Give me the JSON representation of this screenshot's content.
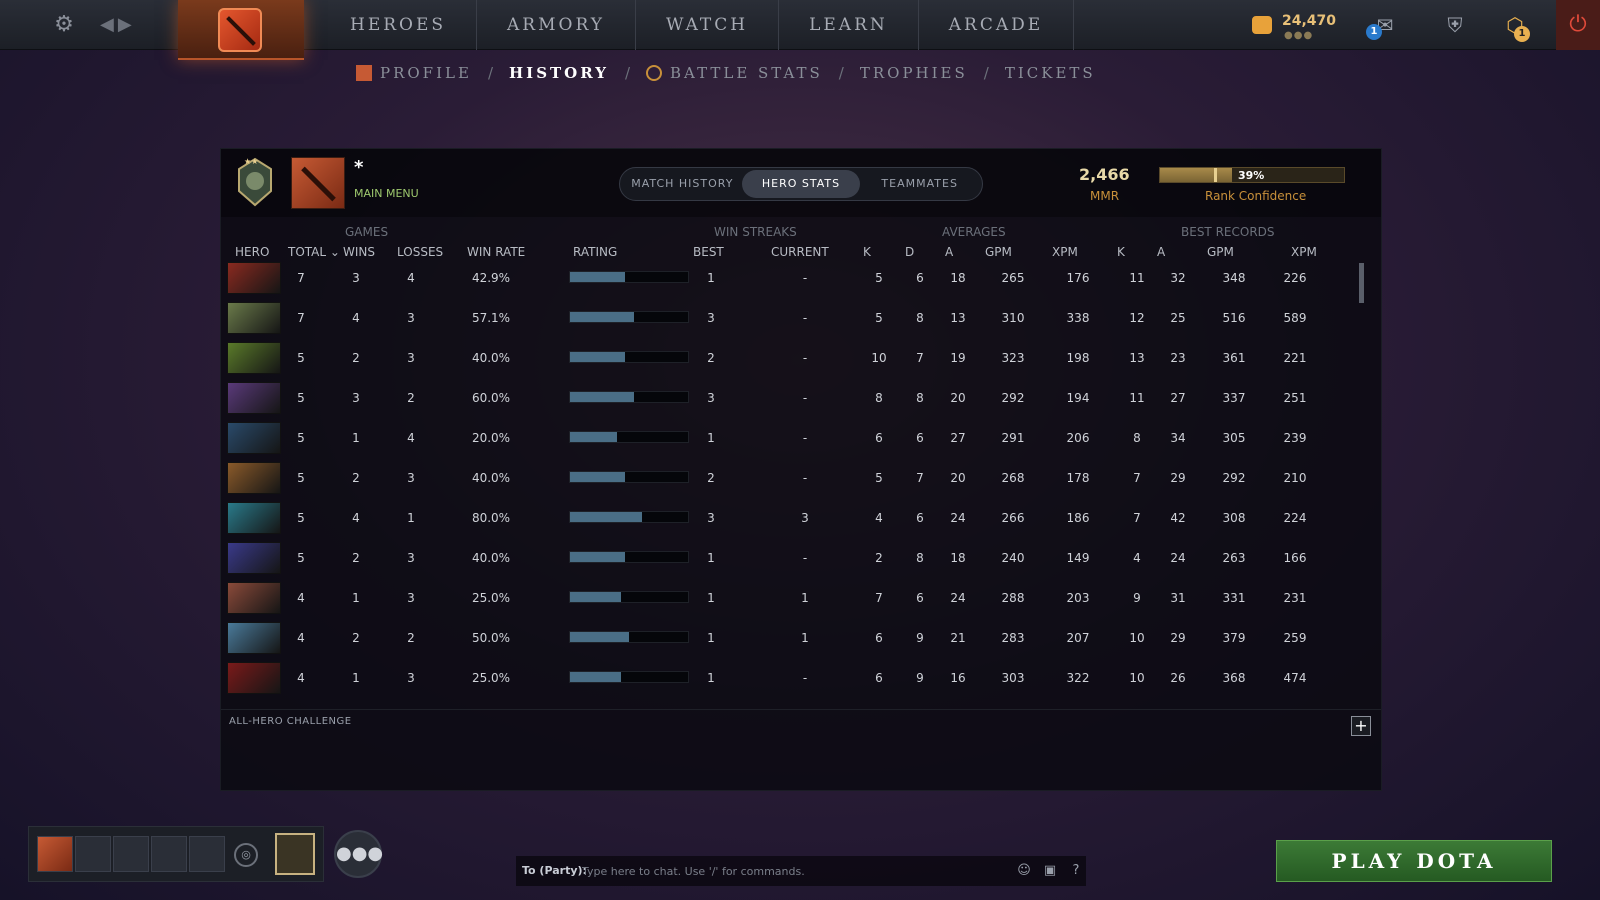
{
  "nav": {
    "items": [
      "HEROES",
      "ARMORY",
      "WATCH",
      "LEARN",
      "ARCADE"
    ],
    "currency": "24,470",
    "notification_count": "1",
    "plus_badge": "1"
  },
  "subnav": {
    "profile": "PROFILE",
    "history": "HISTORY",
    "battle_stats": "BATTLE STATS",
    "trophies": "TROPHIES",
    "tickets": "TICKETS",
    "separator": "/"
  },
  "profile": {
    "name": "*",
    "status": "MAIN MENU",
    "mmr": "2,466",
    "mmr_label": "MMR",
    "rank_confidence_pct": "39%",
    "rank_confidence_value": 39,
    "rank_confidence_label": "Rank Confidence"
  },
  "tabs": {
    "match_history": "MATCH HISTORY",
    "hero_stats": "HERO STATS",
    "teammates": "TEAMMATES"
  },
  "table": {
    "groups": {
      "games": "GAMES",
      "win_streaks": "WIN STREAKS",
      "averages": "AVERAGES",
      "best_records": "BEST RECORDS"
    },
    "headers": {
      "hero": "HERO",
      "total": "TOTAL ⌄",
      "wins": "WINS",
      "losses": "LOSSES",
      "win_rate": "WIN RATE",
      "rating": "RATING",
      "best": "BEST",
      "current": "CURRENT",
      "k": "K",
      "d": "D",
      "a": "A",
      "gpm": "GPM",
      "xpm": "XPM",
      "br_k": "K",
      "br_a": "A",
      "br_gpm": "GPM",
      "br_xpm": "XPM"
    },
    "rows": [
      {
        "hero_color": "#8a2a20",
        "total": "7",
        "wins": "3",
        "losses": "4",
        "win_rate": "42.9%",
        "rating": 0.47,
        "best": "1",
        "current": "-",
        "k": "5",
        "d": "6",
        "a": "18",
        "gpm": "265",
        "xpm": "176",
        "br_k": "11",
        "br_a": "32",
        "br_gpm": "348",
        "br_xpm": "226"
      },
      {
        "hero_color": "#6a7a4a",
        "total": "7",
        "wins": "4",
        "losses": "3",
        "win_rate": "57.1%",
        "rating": 0.54,
        "best": "3",
        "current": "-",
        "k": "5",
        "d": "8",
        "a": "13",
        "gpm": "310",
        "xpm": "338",
        "br_k": "12",
        "br_a": "25",
        "br_gpm": "516",
        "br_xpm": "589"
      },
      {
        "hero_color": "#5a7a2a",
        "total": "5",
        "wins": "2",
        "losses": "3",
        "win_rate": "40.0%",
        "rating": 0.47,
        "best": "2",
        "current": "-",
        "k": "10",
        "d": "7",
        "a": "19",
        "gpm": "323",
        "xpm": "198",
        "br_k": "13",
        "br_a": "23",
        "br_gpm": "361",
        "br_xpm": "221"
      },
      {
        "hero_color": "#5a3a7a",
        "total": "5",
        "wins": "3",
        "losses": "2",
        "win_rate": "60.0%",
        "rating": 0.54,
        "best": "3",
        "current": "-",
        "k": "8",
        "d": "8",
        "a": "20",
        "gpm": "292",
        "xpm": "194",
        "br_k": "11",
        "br_a": "27",
        "br_gpm": "337",
        "br_xpm": "251"
      },
      {
        "hero_color": "#2a4a6a",
        "total": "5",
        "wins": "1",
        "losses": "4",
        "win_rate": "20.0%",
        "rating": 0.4,
        "best": "1",
        "current": "-",
        "k": "6",
        "d": "6",
        "a": "27",
        "gpm": "291",
        "xpm": "206",
        "br_k": "8",
        "br_a": "34",
        "br_gpm": "305",
        "br_xpm": "239"
      },
      {
        "hero_color": "#8a5a2a",
        "total": "5",
        "wins": "2",
        "losses": "3",
        "win_rate": "40.0%",
        "rating": 0.47,
        "best": "2",
        "current": "-",
        "k": "5",
        "d": "7",
        "a": "20",
        "gpm": "268",
        "xpm": "178",
        "br_k": "7",
        "br_a": "29",
        "br_gpm": "292",
        "br_xpm": "210"
      },
      {
        "hero_color": "#2a7a8a",
        "total": "5",
        "wins": "4",
        "losses": "1",
        "win_rate": "80.0%",
        "rating": 0.61,
        "best": "3",
        "current": "3",
        "k": "4",
        "d": "6",
        "a": "24",
        "gpm": "266",
        "xpm": "186",
        "br_k": "7",
        "br_a": "42",
        "br_gpm": "308",
        "br_xpm": "224"
      },
      {
        "hero_color": "#3a3a8a",
        "total": "5",
        "wins": "2",
        "losses": "3",
        "win_rate": "40.0%",
        "rating": 0.47,
        "best": "1",
        "current": "-",
        "k": "2",
        "d": "8",
        "a": "18",
        "gpm": "240",
        "xpm": "149",
        "br_k": "4",
        "br_a": "24",
        "br_gpm": "263",
        "br_xpm": "166"
      },
      {
        "hero_color": "#8a4a3a",
        "total": "4",
        "wins": "1",
        "losses": "3",
        "win_rate": "25.0%",
        "rating": 0.43,
        "best": "1",
        "current": "1",
        "k": "7",
        "d": "6",
        "a": "24",
        "gpm": "288",
        "xpm": "203",
        "br_k": "9",
        "br_a": "31",
        "br_gpm": "331",
        "br_xpm": "231"
      },
      {
        "hero_color": "#4a7a9a",
        "total": "4",
        "wins": "2",
        "losses": "2",
        "win_rate": "50.0%",
        "rating": 0.5,
        "best": "1",
        "current": "1",
        "k": "6",
        "d": "9",
        "a": "21",
        "gpm": "283",
        "xpm": "207",
        "br_k": "10",
        "br_a": "29",
        "br_gpm": "379",
        "br_xpm": "259"
      },
      {
        "hero_color": "#7a1a1a",
        "total": "4",
        "wins": "1",
        "losses": "3",
        "win_rate": "25.0%",
        "rating": 0.43,
        "best": "1",
        "current": "-",
        "k": "6",
        "d": "9",
        "a": "16",
        "gpm": "303",
        "xpm": "322",
        "br_k": "10",
        "br_a": "26",
        "br_gpm": "368",
        "br_xpm": "474"
      }
    ]
  },
  "footer": {
    "challenge": "ALL-HERO CHALLENGE",
    "plus": "+"
  },
  "chat": {
    "prefix": "To (Party):",
    "placeholder": "Type here to chat. Use '/' for commands.",
    "help": "?"
  },
  "play_button": "PLAY DOTA",
  "colors": {
    "accent_orange": "#e4572e",
    "play_green": "#3c7a36",
    "mmr_gold": "#c8903a",
    "rating_fill": "#4a6e86"
  }
}
